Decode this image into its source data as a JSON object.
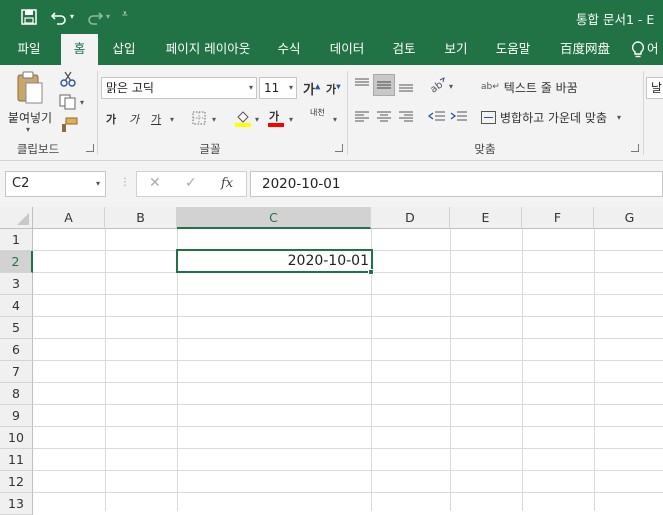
{
  "title": {
    "text": "통합 문서1  -  E"
  },
  "tabs": [
    {
      "label": "파일",
      "active": false
    },
    {
      "label": "홈",
      "active": true
    },
    {
      "label": "삽입",
      "active": false
    },
    {
      "label": "페이지 레이아웃",
      "active": false
    },
    {
      "label": "수식",
      "active": false
    },
    {
      "label": "데이터",
      "active": false
    },
    {
      "label": "검토",
      "active": false
    },
    {
      "label": "보기",
      "active": false
    },
    {
      "label": "도움말",
      "active": false
    },
    {
      "label": "百度网盘",
      "active": false
    },
    {
      "label": "어",
      "active": false
    }
  ],
  "ribbon": {
    "clipboard": {
      "paste_label": "붙여넣기",
      "group_label": "클립보드"
    },
    "font": {
      "font_name": "맑은 고딕",
      "font_size": "11",
      "bold": "가",
      "italic": "가",
      "underline": "가",
      "font_color_letter": "가",
      "phonetic_top": "내천",
      "group_label": "글꼴",
      "grow_letter": "가",
      "shrink_letter": "가"
    },
    "alignment": {
      "wrap_text": "텍스트 줄 바꿈",
      "merge_center": "병합하고 가운데 맞춤",
      "group_label": "맞춤"
    },
    "number_partial": "날"
  },
  "formula_bar": {
    "name_box": "C2",
    "fx_label": "fx",
    "formula": "2020-10-01"
  },
  "sheet": {
    "columns": [
      "A",
      "B",
      "C",
      "D",
      "E",
      "F",
      "G"
    ],
    "selected_column": "C",
    "rows": [
      "1",
      "2",
      "3",
      "4",
      "5",
      "6",
      "7",
      "8",
      "9",
      "10",
      "11",
      "12",
      "13"
    ],
    "selected_row": "2",
    "cells": {
      "C2": "2020-10-01"
    }
  },
  "colors": {
    "accent": "#217346",
    "ribbon_bg": "#f3f3f3",
    "grid_line": "#dadada",
    "highlight_yellow": "#ffff00",
    "font_red": "#ff0000"
  },
  "icons": [
    "save-icon",
    "undo-icon",
    "redo-icon",
    "customize-qat-icon",
    "lightbulb-icon",
    "paste-icon",
    "cut-icon",
    "copy-icon",
    "format-painter-icon",
    "border-icon",
    "fill-color-icon",
    "orientation-icon",
    "indent-icon",
    "name-box-dropdown-icon",
    "cancel-icon",
    "enter-icon"
  ]
}
